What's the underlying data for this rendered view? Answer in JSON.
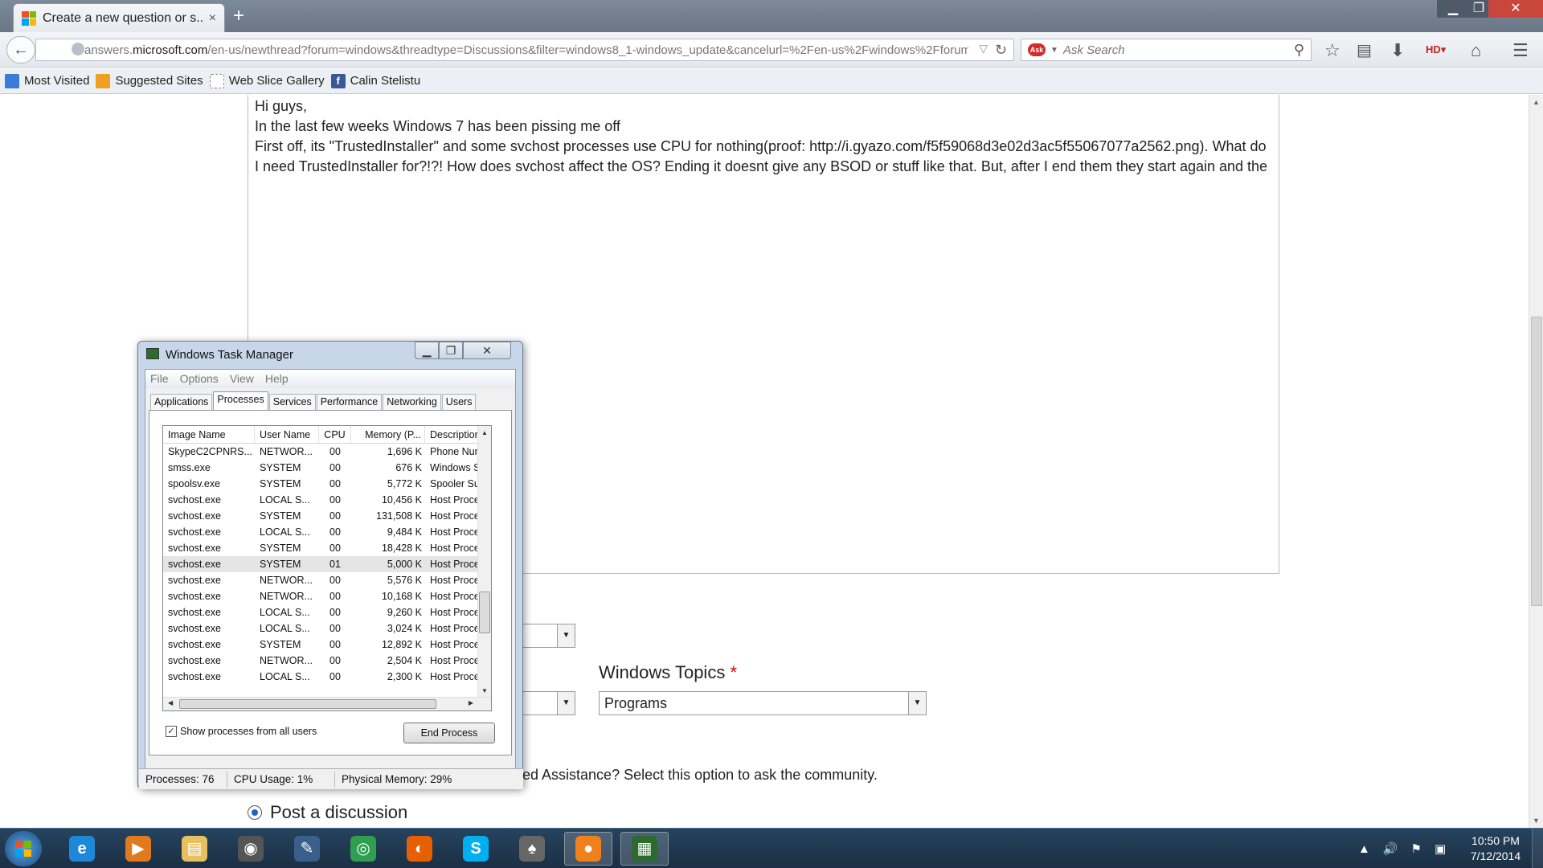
{
  "browser": {
    "tab_title": "Create a new question or s...",
    "tab_close": "×",
    "new_tab": "+",
    "url_prefix": "answers.",
    "url_domain": "microsoft.com",
    "url_rest": "/en-us/newthread?forum=windows&threadtype=Discussions&filter=windows8_1-windows_update&cancelurl=%2Fen-us%2Fwindows%2Fforum%",
    "search_placeholder": "Ask Search",
    "bookmarks": [
      {
        "label": "Most Visited",
        "color": "#3a7bd5"
      },
      {
        "label": "Suggested Sites",
        "color": "#f0a020"
      },
      {
        "label": "Web Slice Gallery",
        "color": "#ffffff"
      },
      {
        "label": "Calin Stelistu",
        "color": "#3b5998"
      }
    ]
  },
  "editor": {
    "lines": [
      "Hi guys,",
      "In the last few weeks Windows 7 has been pissing me off",
      "First off, its \"TrustedInstaller\" and some svchost processes use CPU for nothing(proof: http://i.gyazo.com/f5f59068d3e02d3ac5f55067077a2562.png). What do I need TrustedInstaller for?!?! How does svchost affect the OS? Ending it doesnt give any BSOD or stuff like that. But, after I end them they start again and the"
    ]
  },
  "form": {
    "topics_label": "Windows Topics",
    "required_mark": "*",
    "topics_value": "Programs",
    "need_help_text": "ed Assistance? Select this option to ask the community.",
    "post_discussion": "Post a discussion"
  },
  "task_manager": {
    "title": "Windows Task Manager",
    "menu": [
      "File",
      "Options",
      "View",
      "Help"
    ],
    "tabs": [
      "Applications",
      "Processes",
      "Services",
      "Performance",
      "Networking",
      "Users"
    ],
    "active_tab": "Processes",
    "columns": [
      "Image Name",
      "User Name",
      "CPU",
      "Memory (P...",
      "Descriptior"
    ],
    "rows": [
      [
        "SkypeC2CPNRS...",
        "NETWOR...",
        "00",
        "1,696 K",
        "Phone Num"
      ],
      [
        "smss.exe",
        "SYSTEM",
        "00",
        "676 K",
        "Windows S"
      ],
      [
        "spoolsv.exe",
        "SYSTEM",
        "00",
        "5,772 K",
        "Spooler Su"
      ],
      [
        "svchost.exe",
        "LOCAL S...",
        "00",
        "10,456 K",
        "Host Proce"
      ],
      [
        "svchost.exe",
        "SYSTEM",
        "00",
        "131,508 K",
        "Host Proce"
      ],
      [
        "svchost.exe",
        "LOCAL S...",
        "00",
        "9,484 K",
        "Host Proce"
      ],
      [
        "svchost.exe",
        "SYSTEM",
        "00",
        "18,428 K",
        "Host Proce"
      ],
      [
        "svchost.exe",
        "SYSTEM",
        "01",
        "5,000 K",
        "Host Proce"
      ],
      [
        "svchost.exe",
        "NETWOR...",
        "00",
        "5,576 K",
        "Host Proce"
      ],
      [
        "svchost.exe",
        "NETWOR...",
        "00",
        "10,168 K",
        "Host Proce"
      ],
      [
        "svchost.exe",
        "LOCAL S...",
        "00",
        "9,260 K",
        "Host Proce"
      ],
      [
        "svchost.exe",
        "LOCAL S...",
        "00",
        "3,024 K",
        "Host Proce"
      ],
      [
        "svchost.exe",
        "SYSTEM",
        "00",
        "12,892 K",
        "Host Proce"
      ],
      [
        "svchost.exe",
        "NETWOR...",
        "00",
        "2,504 K",
        "Host Proce"
      ],
      [
        "svchost.exe",
        "LOCAL S...",
        "00",
        "2,300 K",
        "Host Proce"
      ]
    ],
    "highlighted_row": 7,
    "show_all_label": "Show processes from all users",
    "show_all_checked": "✓",
    "end_process_label": "End Process",
    "status_processes": "Processes: 76",
    "status_cpu": "CPU Usage: 1%",
    "status_memory": "Physical Memory: 29%"
  },
  "taskbar": {
    "apps": [
      {
        "name": "internet-explorer",
        "glyph": "e",
        "color": "#1e88d8"
      },
      {
        "name": "media-player",
        "glyph": "▶",
        "color": "#e07a1c"
      },
      {
        "name": "file-explorer",
        "glyph": "▤",
        "color": "#e8c060"
      },
      {
        "name": "camera-app",
        "glyph": "◉",
        "color": "#555555"
      },
      {
        "name": "notepad-app",
        "glyph": "✎",
        "color": "#3a5f8a"
      },
      {
        "name": "chrome",
        "glyph": "◎",
        "color": "#2e9e4f"
      },
      {
        "name": "firefox",
        "glyph": "◐",
        "color": "#e66000"
      },
      {
        "name": "skype",
        "glyph": "S",
        "color": "#00aff0"
      },
      {
        "name": "cards-app",
        "glyph": "♠",
        "color": "#666666"
      },
      {
        "name": "orange-app",
        "glyph": "●",
        "color": "#f0801c"
      },
      {
        "name": "task-manager-app",
        "glyph": "▦",
        "color": "#2d6a2d"
      }
    ],
    "clock_time": "10:50 PM",
    "clock_date": "7/12/2014"
  }
}
